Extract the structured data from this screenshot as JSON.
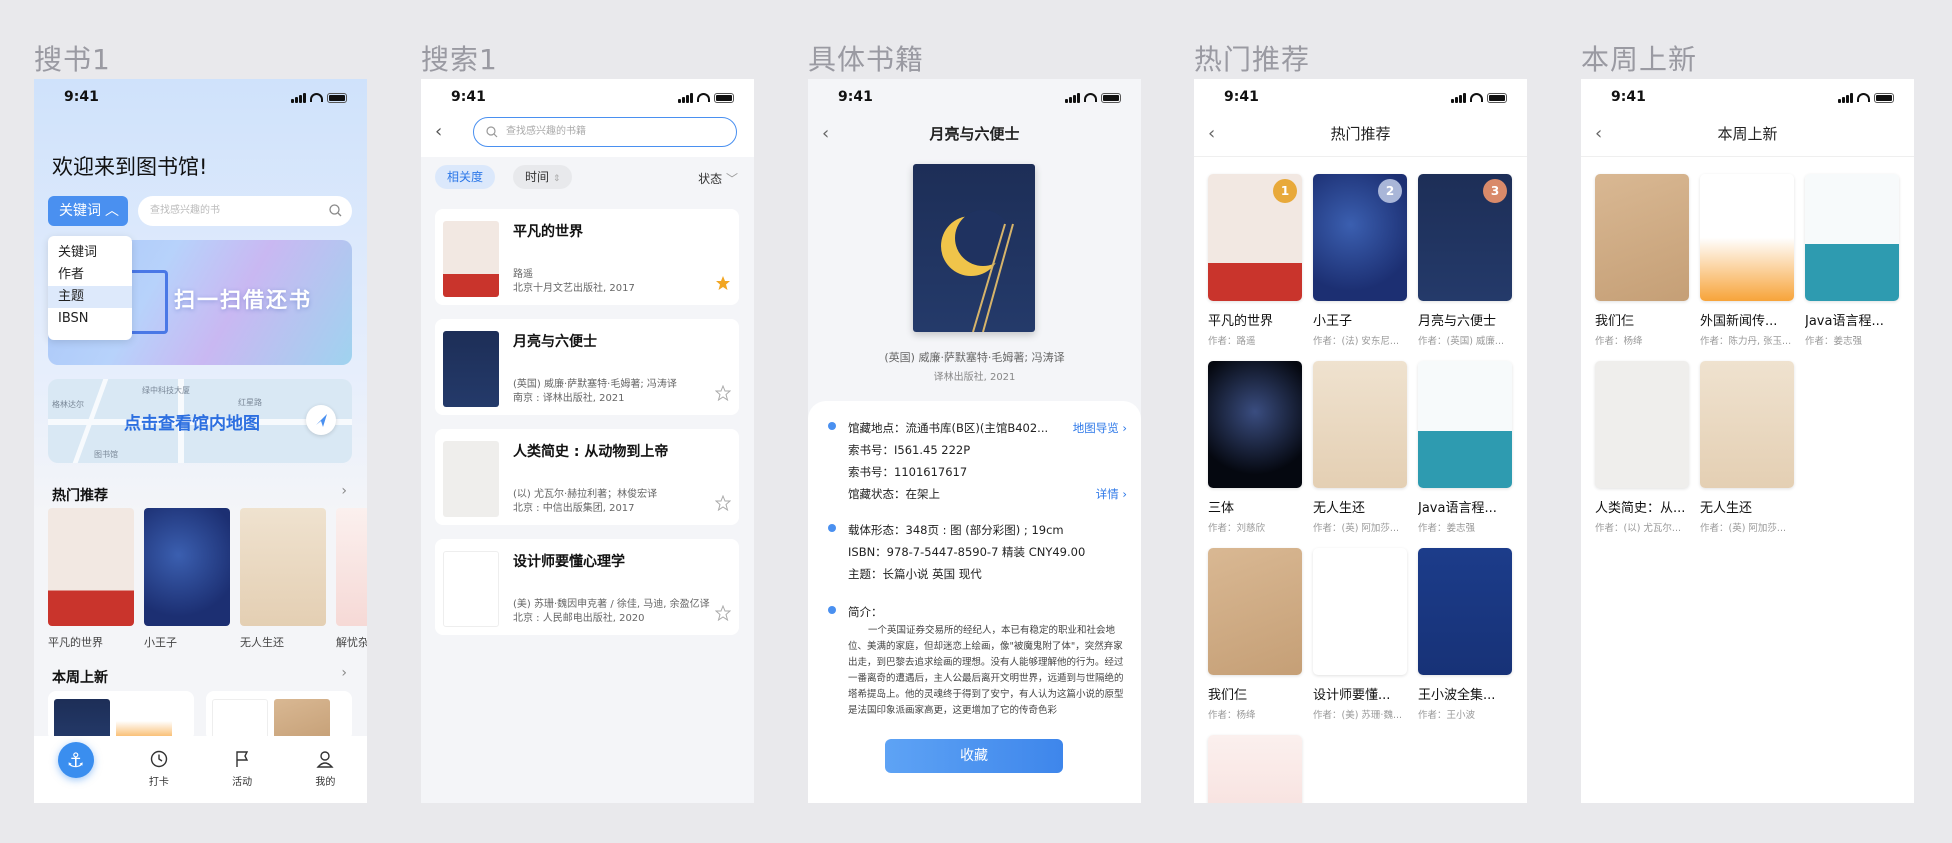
{
  "frames": [
    "搜书1",
    "搜索1",
    "具体书籍",
    "热门推荐",
    "本周上新"
  ],
  "time": "9:41",
  "p1": {
    "welcome": "欢迎来到图书馆!",
    "search_type": "关键词",
    "search_placeholder": "查找感兴趣的书",
    "search_types": [
      "关键词",
      "作者",
      "主题",
      "IBSN"
    ],
    "banner": "扫一扫借还书",
    "map_text": "点击查看馆内地图",
    "map_labels": [
      "绿中科技大厦",
      "格林达尔",
      "红星路",
      "图书馆"
    ],
    "hot_title": "热门推荐",
    "hot_items": [
      "平凡的世界",
      "小王子",
      "无人生还",
      "解忧杂"
    ],
    "new_title": "本周上新",
    "tabs": [
      "打卡",
      "活动",
      "我的"
    ]
  },
  "p2": {
    "search_placeholder": "查找感兴趣的书籍",
    "filters": [
      "相关度",
      "时间"
    ],
    "status_filter": "状态",
    "results": [
      {
        "title": "平凡的世界",
        "author": "路遥",
        "pub": "北京十月文艺出版社, 2017",
        "starred": true
      },
      {
        "title": "月亮与六便士",
        "author": "(英国) 威廉·萨默塞特·毛姆著; 冯涛译",
        "pub": "南京 : 译林出版社, 2021",
        "starred": false
      },
      {
        "title": "人类简史 : 从动物到上帝",
        "author": "(以) 尤瓦尔·赫拉利著；林俊宏译",
        "pub": "北京 : 中信出版集团, 2017",
        "starred": false
      },
      {
        "title": "设计师要懂心理学",
        "author": "(美) 苏珊·魏因申克著 / 徐佳, 马迪, 余盈亿译",
        "pub": "北京 : 人民邮电出版社, 2020",
        "starred": false
      }
    ]
  },
  "p3": {
    "title": "月亮与六便士",
    "author": "(英国) 威廉·萨默塞特·毛姆著; 冯涛译",
    "publisher": "译林出版社, 2021",
    "location": "馆藏地点：流通书库(B区)(主馆B402...",
    "map_link": "地图导览 ›",
    "call_no": "索书号：I561.45 222P",
    "book_no": "索书号：1101617617",
    "state": "馆藏状态：在架上",
    "detail_link": "详情 ›",
    "form": "载体形态：348页 : 图 (部分彩图) ; 19cm",
    "isbn": "ISBN：978-7-5447-8590-7 精装 CNY49.00",
    "subject": "主题：长篇小说 英国 现代",
    "intro_label": "简介：",
    "intro": "一个英国证券交易所的经纪人，本已有稳定的职业和社会地位、美满的家庭，但却迷恋上绘画，像\"被魔鬼附了体\"，突然弃家出走，到巴黎去追求绘画的理想。没有人能够理解他的行为。经过一番离奇的遭遇后，主人公最后离开文明世界，远遁到与世隔绝的塔希提岛上。他的灵魂终于得到了安宁，有人认为这篇小说的原型是法国印象派画家高更，这更增加了它的传奇色彩",
    "button": "收藏"
  },
  "p4": {
    "title": "热门推荐",
    "books": [
      {
        "title": "平凡的世界",
        "author": "作者：路遥",
        "rank": "1",
        "cover": "cv-ord"
      },
      {
        "title": "小王子",
        "author": "作者：(法) 安东尼...",
        "rank": "2",
        "cover": "cv-prince"
      },
      {
        "title": "月亮与六便士",
        "author": "作者：(英国) 威廉...",
        "rank": "3",
        "cover": "cv-moon"
      },
      {
        "title": "三体",
        "author": "作者：刘慈欣",
        "cover": "cv-three"
      },
      {
        "title": "无人生还",
        "author": "作者：(英) 阿加莎...",
        "cover": "cv-wild"
      },
      {
        "title": "Java语言程...",
        "author": "作者：姜志强",
        "cover": "cv-java"
      },
      {
        "title": "我们仨",
        "author": "作者：杨绛",
        "cover": "cv-we"
      },
      {
        "title": "设计师要懂...",
        "author": "作者：(美) 苏珊·魏...",
        "cover": "cv-design"
      },
      {
        "title": "王小波全集...",
        "author": "作者：王小波",
        "cover": "cv-wxb"
      },
      {
        "title": "",
        "author": "",
        "cover": "cv-zh"
      }
    ]
  },
  "p5": {
    "title": "本周上新",
    "books": [
      {
        "title": "我们仨",
        "author": "作者：杨绛",
        "cover": "cv-we"
      },
      {
        "title": "外国新闻传...",
        "author": "作者：陈力丹, 张玉...",
        "cover": "cv-news"
      },
      {
        "title": "Java语言程...",
        "author": "作者：姜志强",
        "cover": "cv-java"
      },
      {
        "title": "人类简史：从...",
        "author": "作者：(以) 尤瓦尔...",
        "cover": "cv-human"
      },
      {
        "title": "无人生还",
        "author": "作者：(英) 阿加莎...",
        "cover": "cv-wild"
      }
    ]
  },
  "colors": {
    "accent": "#4a90f0",
    "rank1": "#e8a93a",
    "rank2": "#a9b6d8",
    "rank3": "#d98a6a"
  }
}
